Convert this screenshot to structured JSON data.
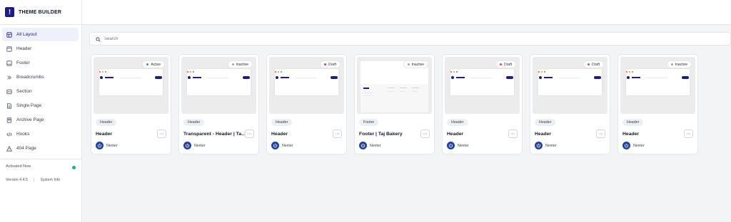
{
  "app": {
    "logo_glyph": "!",
    "title": "THEME BUILDER"
  },
  "sidebar": {
    "items": [
      {
        "label": "All Layout",
        "icon": "layout-grid-icon",
        "active": true
      },
      {
        "label": "Header",
        "icon": "header-icon",
        "active": false
      },
      {
        "label": "Footer",
        "icon": "footer-icon",
        "active": false
      },
      {
        "label": "Breadcrumbs",
        "icon": "double-chevron-icon",
        "active": false
      },
      {
        "label": "Section",
        "icon": "section-icon",
        "active": false
      },
      {
        "label": "Single Page",
        "icon": "single-page-icon",
        "active": false
      },
      {
        "label": "Archive Page",
        "icon": "archive-icon",
        "active": false
      },
      {
        "label": "Hooks",
        "icon": "code-icon",
        "active": false
      },
      {
        "label": "404 Page",
        "icon": "warning-icon",
        "active": false
      }
    ],
    "activated_label": "Activated Now",
    "version": "Version 4.4.5",
    "system_info": "System Info"
  },
  "search": {
    "placeholder": "Search"
  },
  "colors": {
    "brand": "#1e1b8f",
    "active": "#10b981",
    "draft": "#ef4444",
    "inactive": "#9ca3af"
  },
  "cards": [
    {
      "type": "Header",
      "title": "Header",
      "status": "Active",
      "author": "Nexter",
      "thumb": "header"
    },
    {
      "type": "Header",
      "title": "Transparent - Header | Taj ...",
      "status": "Inactive",
      "author": "Nexter",
      "thumb": "header"
    },
    {
      "type": "Header",
      "title": "Header",
      "status": "Draft",
      "author": "Nexter",
      "thumb": "header"
    },
    {
      "type": "Footer",
      "title": "Footer | Taj Bakery",
      "status": "Inactive",
      "author": "Nexter",
      "thumb": "footer"
    },
    {
      "type": "Header",
      "title": "Header",
      "status": "Draft",
      "author": "Nexter",
      "thumb": "header"
    },
    {
      "type": "Header",
      "title": "Header",
      "status": "Draft",
      "author": "Nexter",
      "thumb": "header"
    },
    {
      "type": "Header",
      "title": "Header",
      "status": "Inactive",
      "author": "Nexter",
      "thumb": "header"
    }
  ],
  "more_glyph": "···"
}
